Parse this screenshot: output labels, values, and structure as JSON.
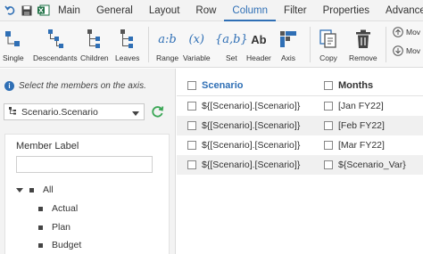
{
  "menu": {
    "items": [
      "Main",
      "General",
      "Layout",
      "Row",
      "Column",
      "Filter",
      "Properties",
      "Advanced"
    ],
    "active": "Column"
  },
  "ribbon": {
    "buttons": {
      "single": "Single",
      "descendants": "Descendants",
      "children": "Children",
      "leaves": "Leaves",
      "range": "Range",
      "variable": "Variable",
      "set": "Set",
      "header": "Header",
      "axis": "Axis",
      "copy": "Copy",
      "remove": "Remove",
      "move_up": "Mov",
      "move_down": "Mov"
    },
    "glyphs": {
      "range": "a:b",
      "variable": "(x)",
      "set": "{a,b}",
      "header": "Ab"
    }
  },
  "left": {
    "hint": "Select the members on the axis.",
    "dimension_select": "Scenario.Scenario",
    "member_label": "Member Label",
    "member_filter_value": "",
    "tree": {
      "root": "All",
      "children": [
        "Actual",
        "Plan",
        "Budget"
      ]
    }
  },
  "grid": {
    "headers": [
      "Scenario",
      "Months"
    ],
    "rows": [
      [
        "${[Scenario].[Scenario]}",
        "[Jan FY22]"
      ],
      [
        "${[Scenario].[Scenario]}",
        "[Feb FY22]"
      ],
      [
        "${[Scenario].[Scenario]}",
        "[Mar FY22]"
      ],
      [
        "${[Scenario].[Scenario]}",
        "${Scenario_Var}"
      ]
    ]
  },
  "colors": {
    "accent": "#2f6fb5",
    "refresh": "#3aa655",
    "excel_green": "#1e7145"
  }
}
